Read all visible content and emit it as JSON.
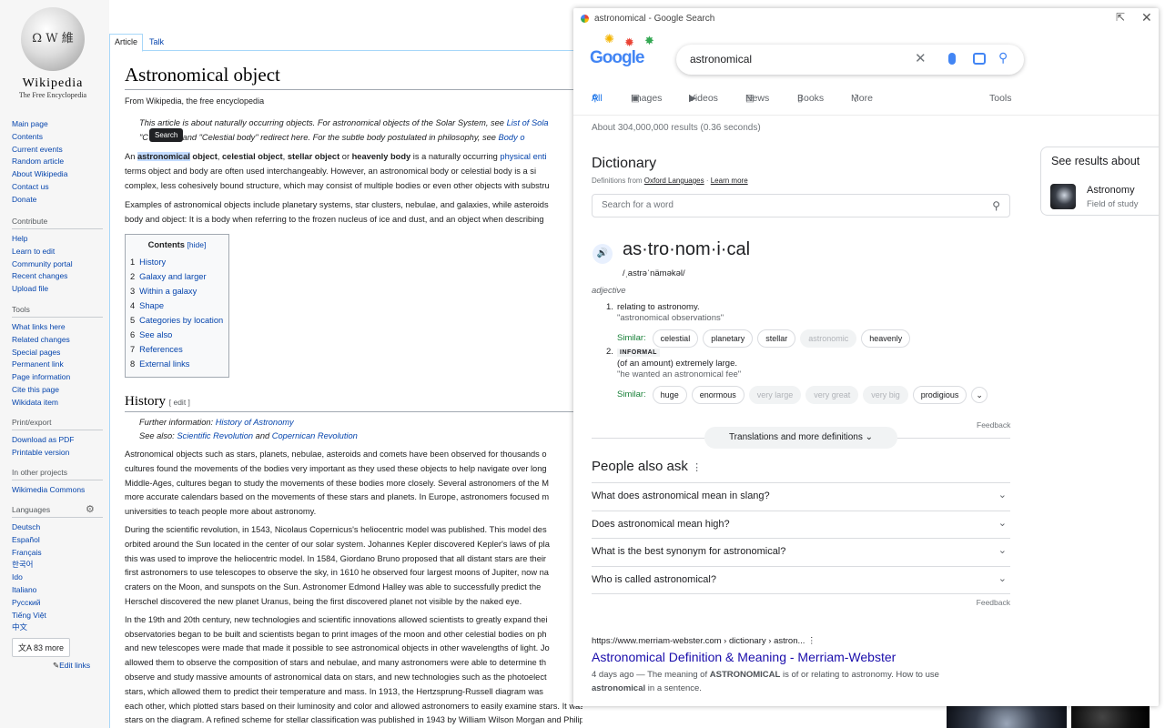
{
  "wiki": {
    "logo": {
      "wordmark": "Wikipedia",
      "tagline": "The Free Encyclopedia"
    },
    "tabs": [
      "Article",
      "Talk"
    ],
    "title": "Astronomical object",
    "from": "From Wikipedia, the free encyclopedia",
    "hatnote_1a": "This article is about naturally occurring objects. For astronomical objects of the Solar System, see ",
    "hatnote_1b": "List of Sola",
    "hatnote_2a": "\"C",
    "hatnote_2b": "bject\" and \"Celestial body\" redirect here. For the subtle body postulated in philosophy, see ",
    "hatnote_2c": "Body o",
    "tooltip": "Search",
    "p1": {
      "a": "An ",
      "hl": "astronomical",
      "b": " object",
      "c": ", ",
      "d": "celestial object",
      "e": ", ",
      "f": "stellar object",
      "g": " or ",
      "h": "heavenly body",
      "i": " is a naturally occurring ",
      "j": "physical enti"
    },
    "p1_l2": "terms object and body are often used interchangeably. However, an astronomical body or celestial body is a si",
    "p1_l3": "complex, less cohesively bound structure, which may consist of multiple bodies or even other objects with substru",
    "p2_l1": "Examples of astronomical objects include planetary systems, star clusters, nebulae, and galaxies, while asteroids",
    "p2_l2": "body and object: It is a body when referring to the frozen nucleus of ice and dust, and an object when describing",
    "toc": {
      "title": "Contents",
      "hide": "[hide]",
      "items": [
        {
          "num": "1",
          "label": "History"
        },
        {
          "num": "2",
          "label": "Galaxy and larger"
        },
        {
          "num": "3",
          "label": "Within a galaxy"
        },
        {
          "num": "4",
          "label": "Shape"
        },
        {
          "num": "5",
          "label": "Categories by location"
        },
        {
          "num": "6",
          "label": "See also"
        },
        {
          "num": "7",
          "label": "References"
        },
        {
          "num": "8",
          "label": "External links"
        }
      ]
    },
    "history": {
      "heading": "History",
      "edit": "[ edit ]",
      "further_a": "Further information: ",
      "further_b": "History of Astronomy",
      "see_a": "See also: ",
      "see_b": "Scientific Revolution",
      "see_c": " and ",
      "see_d": "Copernican Revolution"
    },
    "body_lines": [
      "Astronomical objects such as stars, planets, nebulae, asteroids and comets have been observed for thousands o",
      "cultures found the movements of the bodies very important as they used these objects to help navigate over long",
      "Middle-Ages, cultures began to study the movements of these bodies more closely. Several astronomers of the M",
      "more accurate calendars based on the movements of these stars and planets. In Europe, astronomers focused m",
      "universities to teach people more about astronomy.",
      "",
      "During the scientific revolution, in 1543, Nicolaus Copernicus's heliocentric model was published. This model des",
      "orbited around the Sun located in the center of our solar system. Johannes Kepler discovered Kepler's laws of pla",
      "this was used to improve the heliocentric model. In 1584, Giordano Bruno proposed that all distant stars are their",
      "first astronomers to use telescopes to observe the sky, in 1610 he observed four largest moons of Jupiter, now na",
      "craters on the Moon, and sunspots on the Sun. Astronomer Edmond Halley was able to successfully predict the",
      "Herschel discovered the new planet Uranus, being the first discovered planet not visible by the naked eye.",
      "",
      "In the 19th and 20th century, new technologies and scientific innovations allowed scientists to greatly expand thei",
      "observatories began to be built and scientists began to print images of the moon and other celestial bodies on ph",
      "and new telescopes were made that made it possible to see astronomical objects in other wavelengths of light. Jo",
      "allowed them to observe the composition of stars and nebulae, and many astronomers were able to determine th",
      "observe and study massive amounts of astronomical data on stars, and new technologies such as the photoelect",
      "stars, which allowed them to predict their temperature and mass. In 1913, the Hertzsprung-Russell diagram was",
      "each other, which plotted stars based on their luminosity and color and allowed astronomers to easily examine stars. It was found that stars commonly fell on a band of stars called the main-sequence",
      "stars on the diagram. A refined scheme for stellar classification was published in 1943 by William Wilson Morgan and Philip Childs Keenan based on the Hertzsprung-Russel Diagram. Astronomers also"
    ],
    "sidebar": {
      "nav": [
        "Main page",
        "Contents",
        "Current events",
        "Random article",
        "About Wikipedia",
        "Contact us",
        "Donate"
      ],
      "contribute": {
        "title": "Contribute",
        "items": [
          "Help",
          "Learn to edit",
          "Community portal",
          "Recent changes",
          "Upload file"
        ]
      },
      "tools": {
        "title": "Tools",
        "items": [
          "What links here",
          "Related changes",
          "Special pages",
          "Permanent link",
          "Page information",
          "Cite this page",
          "Wikidata item"
        ]
      },
      "print": {
        "title": "Print/export",
        "items": [
          "Download as PDF",
          "Printable version"
        ]
      },
      "other": {
        "title": "In other projects",
        "items": [
          "Wikimedia Commons"
        ]
      },
      "languages": {
        "title": "Languages",
        "items": [
          "Deutsch",
          "Español",
          "Français",
          "한국어",
          "Ido",
          "Italiano",
          "Русский",
          "Tiếng Việt",
          "中文"
        ],
        "more": "83 more",
        "edit": "Edit links"
      }
    }
  },
  "google": {
    "window_title": "astronomical - Google Search",
    "logo_text": "Google",
    "query": "astronomical",
    "tabs": [
      "All",
      "Images",
      "Videos",
      "News",
      "Books",
      "More"
    ],
    "tools": "Tools",
    "stats": "About 304,000,000 results (0.36 seconds)",
    "dictionary": {
      "heading": "Dictionary",
      "source_a": "Definitions from ",
      "source_b": "Oxford Languages",
      "source_c": " · ",
      "source_d": "Learn more",
      "search_placeholder": "Search for a word",
      "word": "as·tro·nom·i·cal",
      "pronunciation": "/ˌastrəˈnäməkəl/",
      "pos": "adjective",
      "def1": {
        "num": "1.",
        "text": "relating to astronomy.",
        "example": "\"astronomical observations\""
      },
      "similar_label": "Similar:",
      "def1_similar": [
        "celestial",
        "planetary",
        "stellar",
        "astronomic",
        "heavenly"
      ],
      "def2": {
        "num": "2.",
        "tag": "INFORMAL",
        "text": "(of an amount) extremely large.",
        "example": "\"he wanted an astronomical fee\""
      },
      "def2_similar": [
        "huge",
        "enormous",
        "very large",
        "very great",
        "very big",
        "prodigious"
      ],
      "feedback": "Feedback",
      "more_button": "Translations and more definitions"
    },
    "paa": {
      "heading": "People also ask",
      "questions": [
        "What does astronomical mean in slang?",
        "Does astronomical mean high?",
        "What is the best synonym for astronomical?",
        "Who is called astronomical?"
      ],
      "feedback": "Feedback"
    },
    "result": {
      "url": "https://www.merriam-webster.com › dictionary › astron...",
      "title": "Astronomical Definition & Meaning - Merriam-Webster",
      "snippet_a": "4 days ago — The meaning of ",
      "snippet_b": "ASTRONOMICAL",
      "snippet_c": " is of or relating to astronomy. How to use",
      "snippet_d": "astronomical",
      "snippet_e": " in a sentence."
    },
    "side": {
      "heading": "See results about",
      "entity": "Astronomy",
      "sub": "Field of study"
    }
  }
}
